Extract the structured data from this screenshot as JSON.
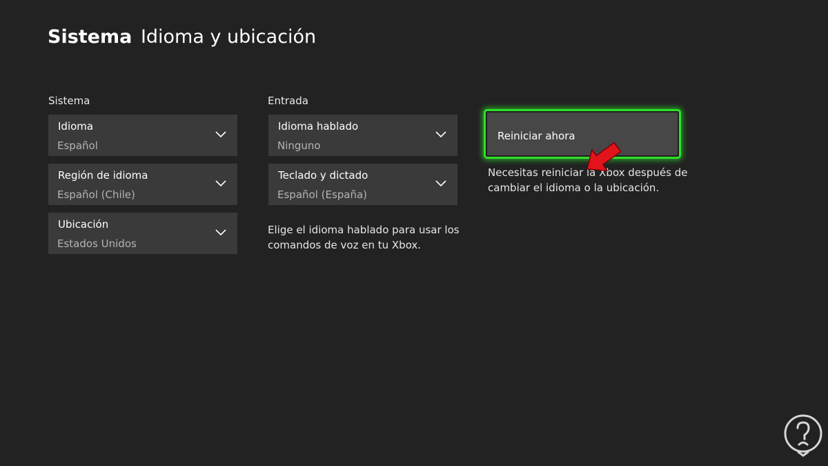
{
  "header": {
    "section": "Sistema",
    "page": "Idioma y ubicación"
  },
  "sistema": {
    "label": "Sistema",
    "items": [
      {
        "title": "Idioma",
        "value": "Español"
      },
      {
        "title": "Región de idioma",
        "value": "Español (Chile)"
      },
      {
        "title": "Ubicación",
        "value": "Estados Unidos"
      }
    ]
  },
  "entrada": {
    "label": "Entrada",
    "items": [
      {
        "title": "Idioma hablado",
        "value": "Ninguno"
      },
      {
        "title": "Teclado y dictado",
        "value": "Español (España)"
      }
    ],
    "help_line1": "Elige el idioma hablado para usar los",
    "help_line2": "comandos de voz en tu Xbox."
  },
  "restart": {
    "button_label": "Reiniciar ahora",
    "note_line1": "Necesitas reiniciar la Xbox después de",
    "note_line2": "cambiar el idioma o la ubicación."
  },
  "colors": {
    "background": "#222222",
    "control": "#3a3a3a",
    "focus": "#2fe02a",
    "annotation_arrow": "#e3131b"
  },
  "icons": [
    "chevron-down-icon",
    "pointer-arrow-icon",
    "watermark-logo-icon"
  ]
}
